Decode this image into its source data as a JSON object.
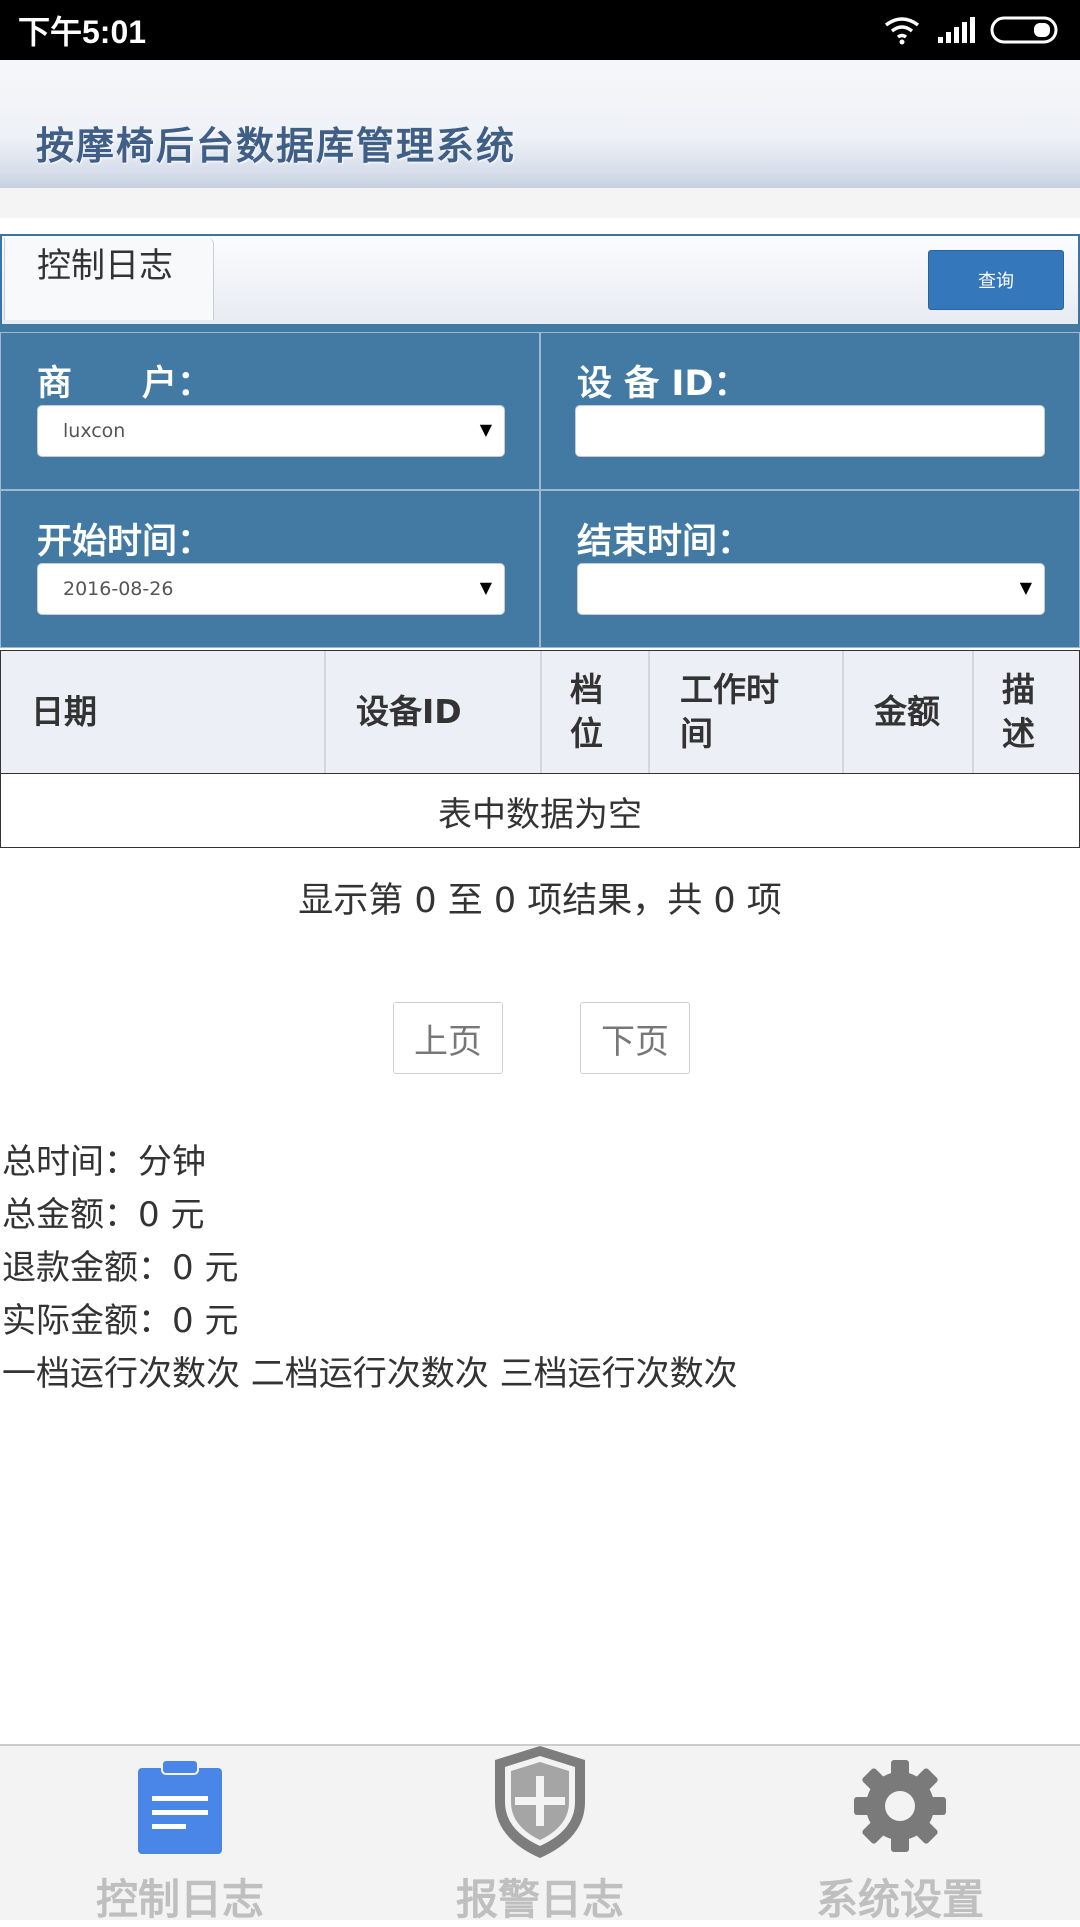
{
  "status_bar": {
    "time": "下午5:01"
  },
  "header": {
    "title": "按摩椅后台数据库管理系统"
  },
  "tabs": [
    {
      "label": "控制日志"
    }
  ],
  "toolbar": {
    "query_label": "查询"
  },
  "filters": {
    "merchant_label": "商　　户：",
    "merchant_value": "luxcon",
    "device_id_label": "设 备 ID：",
    "device_id_value": "",
    "start_time_label": "开始时间：",
    "start_time_value": "2016-08-26",
    "end_time_label": "结束时间：",
    "end_time_value": ""
  },
  "table": {
    "columns": [
      "日期",
      "设备ID",
      "档位",
      "工作时间",
      "金额",
      "描述"
    ],
    "empty_text": "表中数据为空"
  },
  "info_text": "显示第 0 至 0 项结果，共 0 项",
  "pagination": {
    "prev_label": "上页",
    "next_label": "下页"
  },
  "summary": {
    "total_time": "总时间：分钟",
    "total_amount": "总金额：0 元",
    "refund_amount": "退款金额：0 元",
    "actual_amount": "实际金额：0 元",
    "level_runs": "一档运行次数次 二档运行次数次 三档运行次数次"
  },
  "bottom_nav": [
    {
      "label": "控制日志",
      "icon": "clipboard-icon",
      "active": true,
      "color": "#4a86e8"
    },
    {
      "label": "报警日志",
      "icon": "shield-plus-icon",
      "active": false,
      "color": "#7a7a7a"
    },
    {
      "label": "系统设置",
      "icon": "gear-icon",
      "active": false,
      "color": "#7a7a7a"
    }
  ]
}
